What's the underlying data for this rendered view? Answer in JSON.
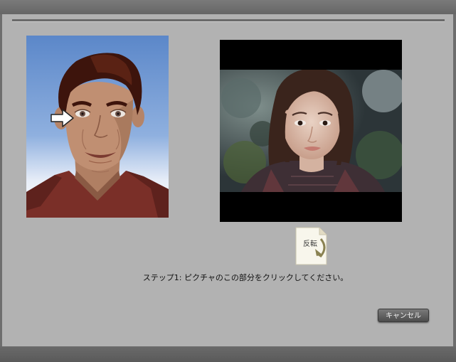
{
  "toolbar": {
    "flip_label": "反転"
  },
  "instruction": {
    "text": "ステップ1: ピクチャのこの部分をクリックしてください。"
  },
  "actions": {
    "cancel_label": "キャンセル"
  },
  "icons": {
    "pointer": "right-arrow-icon",
    "flip": "flip-icon"
  },
  "colors": {
    "panel_bg": "#b2b2b2",
    "guide_sky": "#5b87c9",
    "shirt": "#7a2f28",
    "skin": "#c08f72"
  }
}
